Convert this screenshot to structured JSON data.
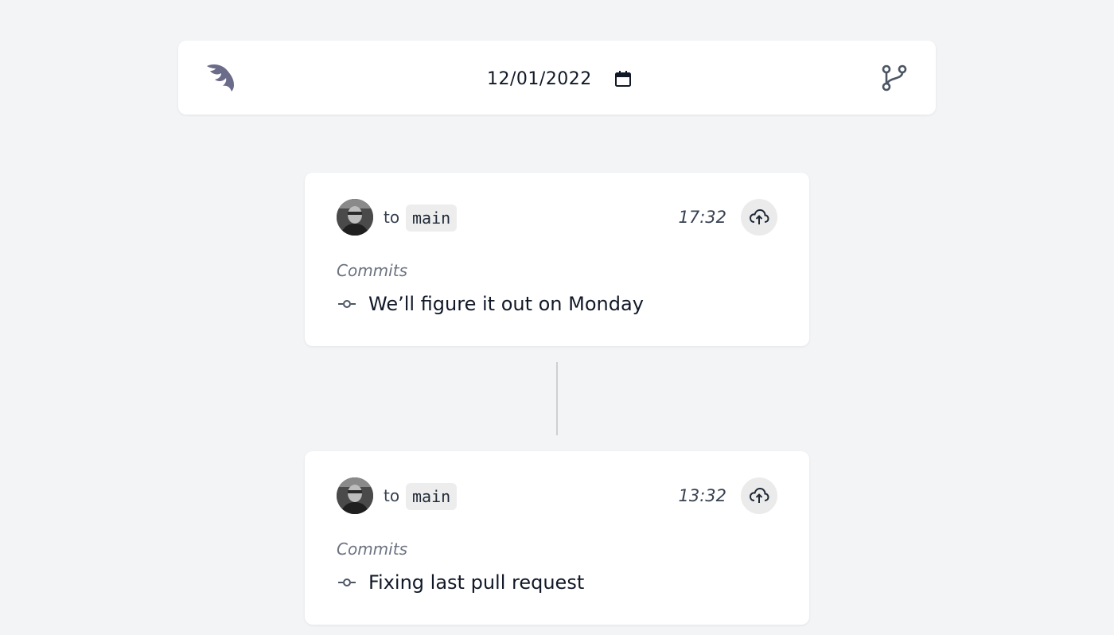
{
  "header": {
    "logo_icon": "feather-logo-icon",
    "date_value": "12/01/2022",
    "calendar_icon": "calendar-icon",
    "branch_icon": "git-branch-icon"
  },
  "pushes": [
    {
      "avatar": "user-avatar",
      "to_label": "to",
      "branch": "main",
      "time": "17:32",
      "push_icon": "cloud-upload-icon",
      "section_label": "Commits",
      "commits": [
        {
          "icon": "git-commit-icon",
          "message": "We’ll figure it out on Monday"
        }
      ]
    },
    {
      "avatar": "user-avatar",
      "to_label": "to",
      "branch": "main",
      "time": "13:32",
      "push_icon": "cloud-upload-icon",
      "section_label": "Commits",
      "commits": [
        {
          "icon": "git-commit-icon",
          "message": "Fixing last pull request"
        }
      ]
    }
  ],
  "colors": {
    "background": "#f3f4f6",
    "card": "#ffffff",
    "logo": "#6b6b8a",
    "tag_bg": "#ededed",
    "muted_text": "#6b7280"
  }
}
